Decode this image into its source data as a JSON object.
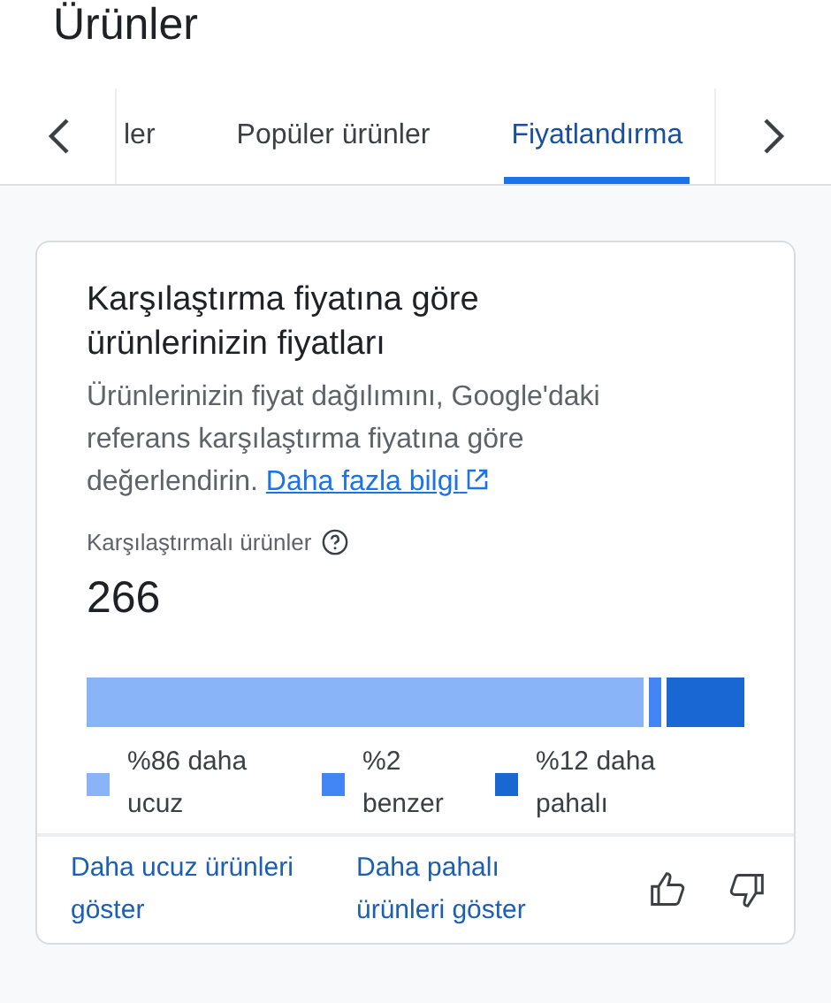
{
  "header": {
    "title": "Ürünler"
  },
  "tabs": [
    {
      "label": "ler",
      "selected": false
    },
    {
      "label": "Popüler ürünler",
      "selected": false
    },
    {
      "label": "Fiyatlandırma",
      "selected": true
    }
  ],
  "card": {
    "title": "Karşılaştırma fiyatına göre ürünlerinizin fiyatları",
    "description": "Ürünlerinizin fiyat dağılımını, Google'daki referans karşılaştırma fiyatına göre değerlendirin.",
    "link": "Daha fazla bilgi",
    "metric_label": "Karşılaştırmalı ürünler",
    "metric_value": "266",
    "segments": [
      {
        "color": "#8ab4f8"
      },
      {
        "color": "#4285f4"
      },
      {
        "color": "#1967d2"
      }
    ],
    "legend": [
      {
        "label": "%86 daha ucuz",
        "color": "#8ab4f8"
      },
      {
        "label": "%2 benzer",
        "color": "#4285f4"
      },
      {
        "label": "%12 daha pahalı",
        "color": "#1967d2"
      }
    ],
    "actions": [
      "Daha ucuz ürünleri göster",
      "Daha pahalı ürünleri göster"
    ]
  }
}
